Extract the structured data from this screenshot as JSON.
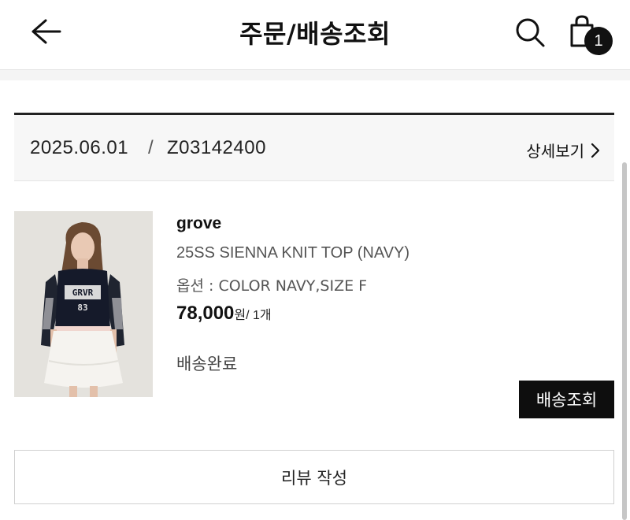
{
  "header": {
    "title": "주문/배송조회",
    "back_icon": "arrow-left-icon",
    "search_icon": "search-icon",
    "cart_icon": "shopping-bag-icon",
    "cart_count": "1"
  },
  "order": {
    "date": "2025.06.01",
    "separator": "/",
    "number": "Z03142400",
    "detail_label": "상세보기",
    "detail_icon": "chevron-right-icon"
  },
  "product": {
    "brand": "grove",
    "name": "25SS SIENNA KNIT TOP (NAVY)",
    "option": "옵션 : COLOR NAVY,SIZE F",
    "price": "78,000",
    "price_unit": "원/ 1개",
    "status": "배송완료",
    "image_alt": "model wearing navy knit top",
    "image_print": "GRVR 83"
  },
  "actions": {
    "track_label": "배송조회",
    "review_label": "리뷰 작성"
  },
  "colors": {
    "accent": "#0e0e0e",
    "border": "#d0d0d0",
    "header_bg": "#f7f7f7"
  }
}
